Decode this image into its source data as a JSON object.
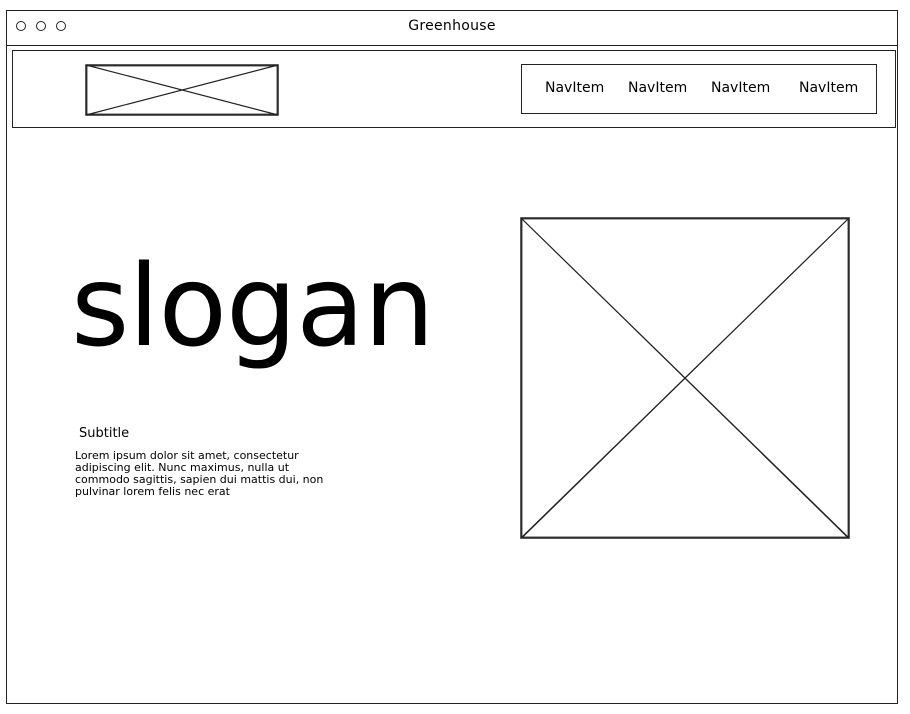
{
  "window": {
    "title": "Greenhouse"
  },
  "header": {
    "nav_items": [
      "NavItem",
      "NavItem",
      "NavItem",
      "NavItem"
    ]
  },
  "hero": {
    "slogan": "slogan",
    "subtitle": "Subtitle",
    "body": "Lorem ipsum dolor sit amet, consectetur adipiscing elit. Nunc maximus, nulla ut commodo sagittis, sapien dui mattis dui, non pulvinar lorem felis nec erat"
  }
}
